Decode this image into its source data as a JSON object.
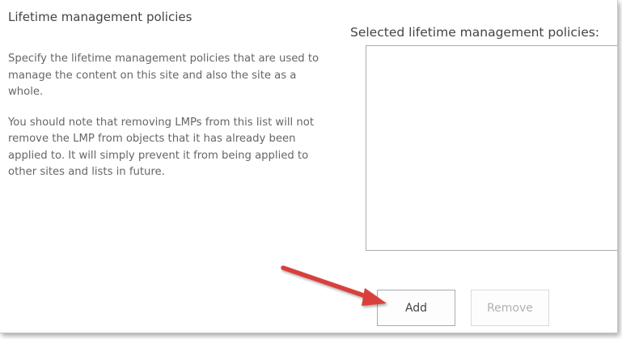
{
  "section": {
    "title": "Lifetime management policies",
    "description_1": "Specify the lifetime management policies that are used to manage the content on this site and also the site as a whole.",
    "description_2": "You should note that removing LMPs from this list will not remove the LMP from objects that it has already been applied to. It will simply prevent it from being applied to other sites and lists in future."
  },
  "list": {
    "label": "Selected lifetime management policies:",
    "items": []
  },
  "buttons": {
    "add_label": "Add",
    "remove_label": "Remove",
    "remove_enabled": false
  },
  "annotation": {
    "arrow_color": "#d9413b"
  }
}
